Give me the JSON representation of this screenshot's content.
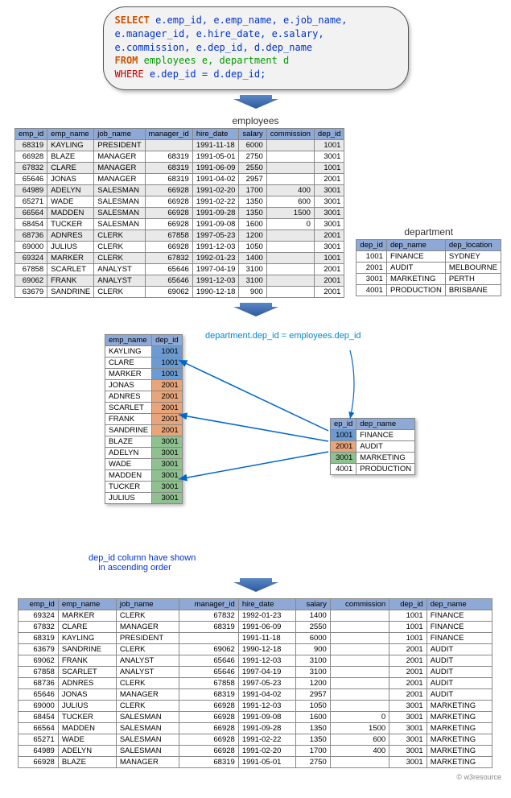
{
  "sql": {
    "select": "SELECT",
    "cols": "e.emp_id,  e.emp_name, e.job_name, e.manager_id, e.hire_date, e.salary, e.commission, e.dep_id, d.dep_name",
    "from": "FROM",
    "tables": "employees e, department d",
    "where": "WHERE",
    "cond": "e.dep_id = d.dep_id;"
  },
  "labels": {
    "employees": "employees",
    "department": "department",
    "join_cond": "department.dep_id = employees.dep_id",
    "asc_note1": "dep_id column have shown",
    "asc_note2": "in ascending order",
    "credit": "© w3resource"
  },
  "emp_headers": [
    "emp_id",
    "emp_name",
    "job_name",
    "manager_id",
    "hire_date",
    "salary",
    "commission",
    "dep_id"
  ],
  "employees": [
    {
      "id": 68319,
      "name": "KAYLING",
      "job": "PRESIDENT",
      "mgr": "",
      "hire": "1991-11-18",
      "sal": 6000,
      "comm": "",
      "dep": 1001,
      "g": 1
    },
    {
      "id": 66928,
      "name": "BLAZE",
      "job": "MANAGER",
      "mgr": 68319,
      "hire": "1991-05-01",
      "sal": 2750,
      "comm": "",
      "dep": 3001,
      "g": 0
    },
    {
      "id": 67832,
      "name": "CLARE",
      "job": "MANAGER",
      "mgr": 68319,
      "hire": "1991-06-09",
      "sal": 2550,
      "comm": "",
      "dep": 1001,
      "g": 1
    },
    {
      "id": 65646,
      "name": "JONAS",
      "job": "MANAGER",
      "mgr": 68319,
      "hire": "1991-04-02",
      "sal": 2957,
      "comm": "",
      "dep": 2001,
      "g": 0
    },
    {
      "id": 64989,
      "name": "ADELYN",
      "job": "SALESMAN",
      "mgr": 66928,
      "hire": "1991-02-20",
      "sal": 1700,
      "comm": 400,
      "dep": 3001,
      "g": 1
    },
    {
      "id": 65271,
      "name": "WADE",
      "job": "SALESMAN",
      "mgr": 66928,
      "hire": "1991-02-22",
      "sal": 1350,
      "comm": 600,
      "dep": 3001,
      "g": 0
    },
    {
      "id": 66564,
      "name": "MADDEN",
      "job": "SALESMAN",
      "mgr": 66928,
      "hire": "1991-09-28",
      "sal": 1350,
      "comm": 1500,
      "dep": 3001,
      "g": 1
    },
    {
      "id": 68454,
      "name": "TUCKER",
      "job": "SALESMAN",
      "mgr": 66928,
      "hire": "1991-09-08",
      "sal": 1600,
      "comm": 0,
      "dep": 3001,
      "g": 0
    },
    {
      "id": 68736,
      "name": "ADNRES",
      "job": "CLERK",
      "mgr": 67858,
      "hire": "1997-05-23",
      "sal": 1200,
      "comm": "",
      "dep": 2001,
      "g": 1
    },
    {
      "id": 69000,
      "name": "JULIUS",
      "job": "CLERK",
      "mgr": 66928,
      "hire": "1991-12-03",
      "sal": 1050,
      "comm": "",
      "dep": 3001,
      "g": 0
    },
    {
      "id": 69324,
      "name": "MARKER",
      "job": "CLERK",
      "mgr": 67832,
      "hire": "1992-01-23",
      "sal": 1400,
      "comm": "",
      "dep": 1001,
      "g": 1
    },
    {
      "id": 67858,
      "name": "SCARLET",
      "job": "ANALYST",
      "mgr": 65646,
      "hire": "1997-04-19",
      "sal": 3100,
      "comm": "",
      "dep": 2001,
      "g": 0
    },
    {
      "id": 69062,
      "name": "FRANK",
      "job": "ANALYST",
      "mgr": 65646,
      "hire": "1991-12-03",
      "sal": 3100,
      "comm": "",
      "dep": 2001,
      "g": 1
    },
    {
      "id": 63679,
      "name": "SANDRINE",
      "job": "CLERK",
      "mgr": 69062,
      "hire": "1990-12-18",
      "sal": 900,
      "comm": "",
      "dep": 2001,
      "g": 0
    }
  ],
  "dep_headers": [
    "dep_id",
    "dep_name",
    "dep_location"
  ],
  "departments": [
    {
      "id": 1001,
      "name": "FINANCE",
      "loc": "SYDNEY"
    },
    {
      "id": 2001,
      "name": "AUDIT",
      "loc": "MELBOURNE"
    },
    {
      "id": 3001,
      "name": "MARKETING",
      "loc": "PERTH"
    },
    {
      "id": 4001,
      "name": "PRODUCTION",
      "loc": "BRISBANE"
    }
  ],
  "join_left_headers": [
    "emp_name",
    "dep_id"
  ],
  "join_left": [
    {
      "name": "KAYLING",
      "dep": 1001,
      "c": "blue"
    },
    {
      "name": "CLARE",
      "dep": 1001,
      "c": "blue"
    },
    {
      "name": "MARKER",
      "dep": 1001,
      "c": "blue"
    },
    {
      "name": "JONAS",
      "dep": 2001,
      "c": "orange"
    },
    {
      "name": "ADNRES",
      "dep": 2001,
      "c": "orange"
    },
    {
      "name": "SCARLET",
      "dep": 2001,
      "c": "orange"
    },
    {
      "name": "FRANK",
      "dep": 2001,
      "c": "orange"
    },
    {
      "name": "SANDRINE",
      "dep": 2001,
      "c": "orange"
    },
    {
      "name": "BLAZE",
      "dep": 3001,
      "c": "green"
    },
    {
      "name": "ADELYN",
      "dep": 3001,
      "c": "green"
    },
    {
      "name": "WADE",
      "dep": 3001,
      "c": "green"
    },
    {
      "name": "MADDEN",
      "dep": 3001,
      "c": "green"
    },
    {
      "name": "TUCKER",
      "dep": 3001,
      "c": "green"
    },
    {
      "name": "JULIUS",
      "dep": 3001,
      "c": "green"
    }
  ],
  "join_right_headers": [
    "ep_id",
    "dep_name"
  ],
  "join_right": [
    {
      "id": 1001,
      "name": "FINANCE",
      "c": "blue"
    },
    {
      "id": 2001,
      "name": "AUDIT",
      "c": "orange"
    },
    {
      "id": 3001,
      "name": "MARKETING",
      "c": "green"
    },
    {
      "id": 4001,
      "name": "PRODUCTION",
      "c": "plain"
    }
  ],
  "result_headers": [
    "emp_id",
    "emp_name",
    "job_name",
    "manager_id",
    "hire_date",
    "salary",
    "commission",
    "dep_id",
    "dep_name"
  ],
  "result": [
    {
      "id": 69324,
      "name": "MARKER",
      "job": "CLERK",
      "mgr": 67832,
      "hire": "1992-01-23",
      "sal": 1400,
      "comm": "",
      "dep": 1001,
      "dname": "FINANCE"
    },
    {
      "id": 67832,
      "name": "CLARE",
      "job": "MANAGER",
      "mgr": 68319,
      "hire": "1991-06-09",
      "sal": 2550,
      "comm": "",
      "dep": 1001,
      "dname": "FINANCE"
    },
    {
      "id": 68319,
      "name": "KAYLING",
      "job": "PRESIDENT",
      "mgr": "",
      "hire": "1991-11-18",
      "sal": 6000,
      "comm": "",
      "dep": 1001,
      "dname": "FINANCE"
    },
    {
      "id": 63679,
      "name": "SANDRINE",
      "job": "CLERK",
      "mgr": 69062,
      "hire": "1990-12-18",
      "sal": 900,
      "comm": "",
      "dep": 2001,
      "dname": "AUDIT"
    },
    {
      "id": 69062,
      "name": "FRANK",
      "job": "ANALYST",
      "mgr": 65646,
      "hire": "1991-12-03",
      "sal": 3100,
      "comm": "",
      "dep": 2001,
      "dname": "AUDIT"
    },
    {
      "id": 67858,
      "name": "SCARLET",
      "job": "ANALYST",
      "mgr": 65646,
      "hire": "1997-04-19",
      "sal": 3100,
      "comm": "",
      "dep": 2001,
      "dname": "AUDIT"
    },
    {
      "id": 68736,
      "name": "ADNRES",
      "job": "CLERK",
      "mgr": 67858,
      "hire": "1997-05-23",
      "sal": 1200,
      "comm": "",
      "dep": 2001,
      "dname": "AUDIT"
    },
    {
      "id": 65646,
      "name": "JONAS",
      "job": "MANAGER",
      "mgr": 68319,
      "hire": "1991-04-02",
      "sal": 2957,
      "comm": "",
      "dep": 2001,
      "dname": "AUDIT"
    },
    {
      "id": 69000,
      "name": "JULIUS",
      "job": "CLERK",
      "mgr": 66928,
      "hire": "1991-12-03",
      "sal": 1050,
      "comm": "",
      "dep": 3001,
      "dname": "MARKETING"
    },
    {
      "id": 68454,
      "name": "TUCKER",
      "job": "SALESMAN",
      "mgr": 66928,
      "hire": "1991-09-08",
      "sal": 1600,
      "comm": 0,
      "dep": 3001,
      "dname": "MARKETING"
    },
    {
      "id": 66564,
      "name": "MADDEN",
      "job": "SALESMAN",
      "mgr": 66928,
      "hire": "1991-09-28",
      "sal": 1350,
      "comm": 1500,
      "dep": 3001,
      "dname": "MARKETING"
    },
    {
      "id": 65271,
      "name": "WADE",
      "job": "SALESMAN",
      "mgr": 66928,
      "hire": "1991-02-22",
      "sal": 1350,
      "comm": 600,
      "dep": 3001,
      "dname": "MARKETING"
    },
    {
      "id": 64989,
      "name": "ADELYN",
      "job": "SALESMAN",
      "mgr": 66928,
      "hire": "1991-02-20",
      "sal": 1700,
      "comm": 400,
      "dep": 3001,
      "dname": "MARKETING"
    },
    {
      "id": 66928,
      "name": "BLAZE",
      "job": "MANAGER",
      "mgr": 68319,
      "hire": "1991-05-01",
      "sal": 2750,
      "comm": "",
      "dep": 3001,
      "dname": "MARKETING"
    }
  ]
}
